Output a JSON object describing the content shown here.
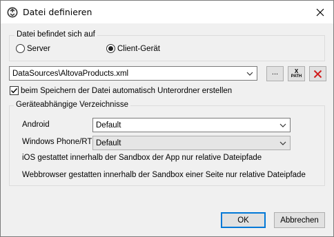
{
  "window": {
    "title": "Datei definieren"
  },
  "location_group": {
    "legend": "Datei befindet sich auf",
    "options": [
      {
        "label": "Server",
        "selected": false
      },
      {
        "label": "Client-Gerät",
        "selected": true
      }
    ]
  },
  "file_path": {
    "value": "DataSources\\AltovaProducts.xml",
    "browse_label": "...",
    "xpath_label_top": "X",
    "xpath_label_bottom": "PATH"
  },
  "auto_subfolders": {
    "label": "beim Speichern der Datei automatisch Unterordner erstellen",
    "checked": true
  },
  "device_dirs": {
    "legend": "Geräteabhängige Verzeichnisse",
    "android_label": "Android",
    "android_value": "Default",
    "windows_label": "Windows Phone/RT",
    "windows_value": "Default",
    "ios_note": "iOS gestattet innerhalb der Sandbox der App nur relative Dateipfade",
    "web_note": "Webbrowser gestatten innerhalb der Sandbox einer Seite nur relative Dateipfade"
  },
  "buttons": {
    "ok": "OK",
    "cancel": "Abbrechen"
  },
  "colors": {
    "accent": "#0078d7",
    "delete_red": "#d11d1d"
  }
}
